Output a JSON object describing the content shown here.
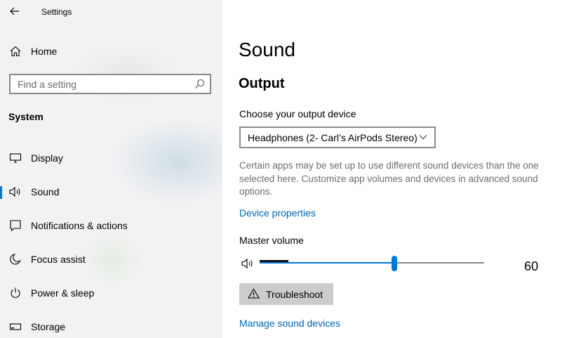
{
  "window": {
    "title": "Settings"
  },
  "sidebar": {
    "home_label": "Home",
    "search": {
      "placeholder": "Find a setting",
      "value": ""
    },
    "section_title": "System",
    "items": [
      {
        "label": "Display",
        "icon": "display-icon",
        "selected": false
      },
      {
        "label": "Sound",
        "icon": "speaker-icon",
        "selected": true
      },
      {
        "label": "Notifications & actions",
        "icon": "notifications-icon",
        "selected": false
      },
      {
        "label": "Focus assist",
        "icon": "moon-icon",
        "selected": false
      },
      {
        "label": "Power & sleep",
        "icon": "power-icon",
        "selected": false
      },
      {
        "label": "Storage",
        "icon": "storage-icon",
        "selected": false
      }
    ]
  },
  "main": {
    "title": "Sound",
    "output": {
      "heading": "Output",
      "device_label": "Choose your output device",
      "device_value": "Headphones (2- Carl’s AirPods Stereo)",
      "description": "Certain apps may be set up to use different sound devices than the one selected here. Customize app volumes and devices in advanced sound options.",
      "device_properties_link": "Device properties",
      "volume_label": "Master volume",
      "volume_value": "60",
      "volume_level": 60,
      "troubleshoot_label": "Troubleshoot",
      "manage_link": "Manage sound devices"
    }
  },
  "colors": {
    "accent": "#0078d7",
    "link": "#0066b4",
    "sidebar_bg": "#f2f2f2"
  }
}
